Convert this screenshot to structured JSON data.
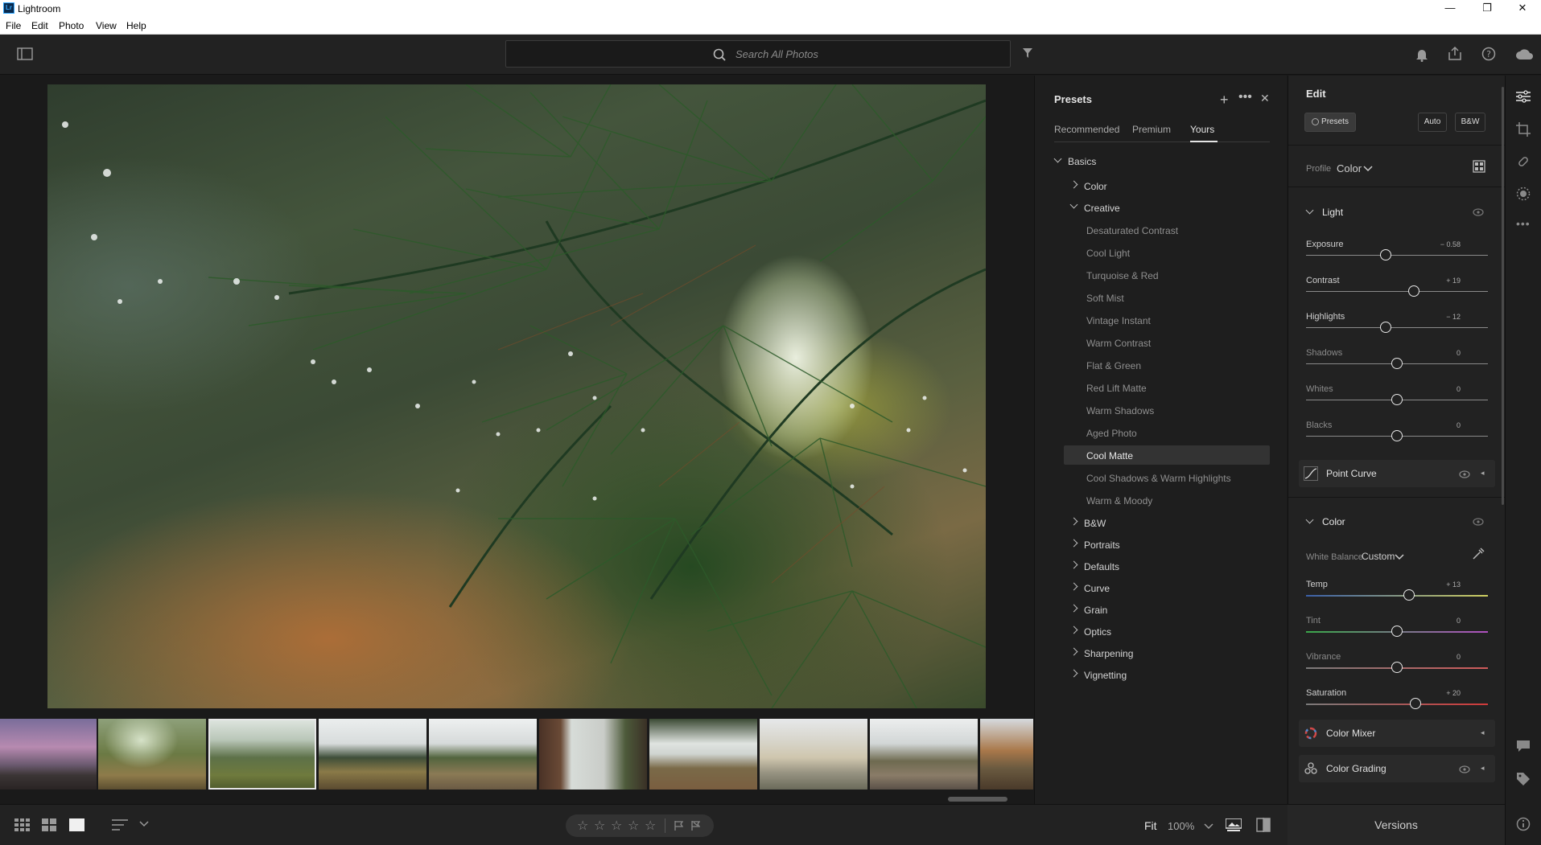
{
  "window": {
    "title": "Lightroom",
    "logo": "Lr",
    "controls": [
      "—",
      "❐",
      "✕"
    ]
  },
  "menu": [
    "File",
    "Edit",
    "Photo",
    "View",
    "Help"
  ],
  "search": {
    "placeholder": "Search All Photos"
  },
  "presets": {
    "title": "Presets",
    "tabs": [
      "Recommended",
      "Premium",
      "Yours"
    ],
    "active_tab": "Yours",
    "groups": {
      "basics": "Basics",
      "color": "Color",
      "creative": "Creative",
      "creative_items": [
        "Desaturated Contrast",
        "Cool Light",
        "Turquoise & Red",
        "Soft Mist",
        "Vintage Instant",
        "Warm Contrast",
        "Flat & Green",
        "Red Lift Matte",
        "Warm Shadows",
        "Aged Photo",
        "Cool Matte",
        "Cool Shadows & Warm Highlights",
        "Warm & Moody"
      ],
      "selected": "Cool Matte",
      "others": [
        "B&W",
        "Portraits",
        "Defaults",
        "Curve",
        "Grain",
        "Optics",
        "Sharpening",
        "Vignetting"
      ]
    }
  },
  "edit": {
    "title": "Edit",
    "presets_button": "Presets",
    "auto_button": "Auto",
    "bw_button": "B&W",
    "profile_label": "Profile",
    "profile_value": "Color",
    "light": {
      "title": "Light",
      "sliders": [
        {
          "label": "Exposure",
          "value": "− 0.58",
          "level": -0.12
        },
        {
          "label": "Contrast",
          "value": "+ 19",
          "level": 0.19
        },
        {
          "label": "Highlights",
          "value": "− 12",
          "level": -0.12
        },
        {
          "label": "Shadows",
          "value": "0",
          "level": 0
        },
        {
          "label": "Whites",
          "value": "0",
          "level": 0
        },
        {
          "label": "Blacks",
          "value": "0",
          "level": 0
        }
      ]
    },
    "point_curve": "Point Curve",
    "color": {
      "title": "Color",
      "wb_label": "White Balance",
      "wb_value": "Custom",
      "sliders": [
        {
          "label": "Temp",
          "value": "+ 13",
          "level": 0.13
        },
        {
          "label": "Tint",
          "value": "0",
          "level": 0
        },
        {
          "label": "Vibrance",
          "value": "0",
          "level": 0
        },
        {
          "label": "Saturation",
          "value": "+ 20",
          "level": 0.2
        }
      ]
    },
    "color_mixer": "Color Mixer",
    "color_grading": "Color Grading"
  },
  "bottom": {
    "fit": "Fit",
    "zoom": "100%",
    "versions": "Versions"
  },
  "colors": {
    "accent": "#e6e6e6",
    "panel": "#222222",
    "selected_row": "#333333"
  }
}
